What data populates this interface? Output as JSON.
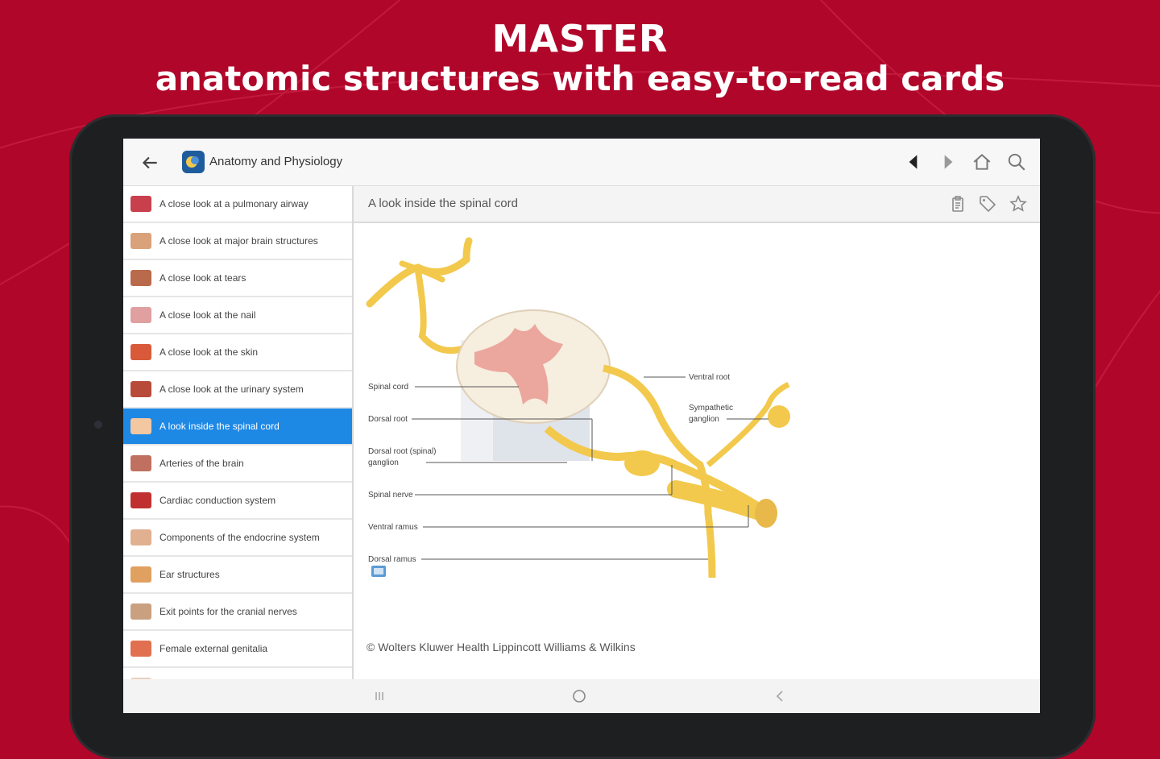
{
  "headline": {
    "title": "MASTER",
    "subtitle": "anatomic structures with easy-to-read cards"
  },
  "colors": {
    "background": "#b0062a",
    "accent_blue": "#1e88e5",
    "nerve": "#f2c94c",
    "tablet_frame": "#1e1f21"
  },
  "appbar": {
    "title": "Anatomy and Physiology",
    "icons": [
      "arrow-back-icon",
      "prev-icon",
      "next-icon",
      "home-icon",
      "search-icon"
    ]
  },
  "sidebar": {
    "items": [
      {
        "label": "A close look at a pulmonary airway",
        "thumb": "#c8404c"
      },
      {
        "label": "A close look at major brain structures",
        "thumb": "#d9a27a"
      },
      {
        "label": "A close look at tears",
        "thumb": "#b86a4a"
      },
      {
        "label": "A close look at the nail",
        "thumb": "#e0a0a0"
      },
      {
        "label": "A close look at the skin",
        "thumb": "#d85a3a"
      },
      {
        "label": "A close look at the urinary system",
        "thumb": "#b84a3a"
      },
      {
        "label": "A look inside the spinal cord",
        "thumb": "#f3c7a0",
        "active": true
      },
      {
        "label": "Arteries of the brain",
        "thumb": "#c07060"
      },
      {
        "label": "Cardiac conduction system",
        "thumb": "#c03030"
      },
      {
        "label": "Components of the endocrine system",
        "thumb": "#e0b090"
      },
      {
        "label": "Ear structures",
        "thumb": "#e0a060"
      },
      {
        "label": "Exit points for the cranial nerves",
        "thumb": "#c9a080"
      },
      {
        "label": "Female external genitalia",
        "thumb": "#e07050"
      },
      {
        "label": "",
        "thumb": "#e8d0c0"
      }
    ]
  },
  "card": {
    "title": "A look inside the spinal cord",
    "icons": [
      "notes-icon",
      "tag-icon",
      "star-icon"
    ],
    "labels": {
      "spinal_cord": "Spinal cord",
      "dorsal_root": "Dorsal root",
      "dorsal_root_ganglion_1": "Dorsal root (spinal)",
      "dorsal_root_ganglion_2": "ganglion",
      "spinal_nerve": "Spinal nerve",
      "ventral_ramus": "Ventral ramus",
      "dorsal_ramus": "Dorsal ramus",
      "ventral_root": "Ventral root",
      "sympathetic_1": "Sympathetic",
      "sympathetic_2": "ganglion"
    },
    "copyright": "© Wolters Kluwer Health Lippincott Williams & Wilkins"
  },
  "navbar": {
    "icons": [
      "recent-apps-icon",
      "home-circle-icon",
      "nav-back-icon"
    ]
  }
}
